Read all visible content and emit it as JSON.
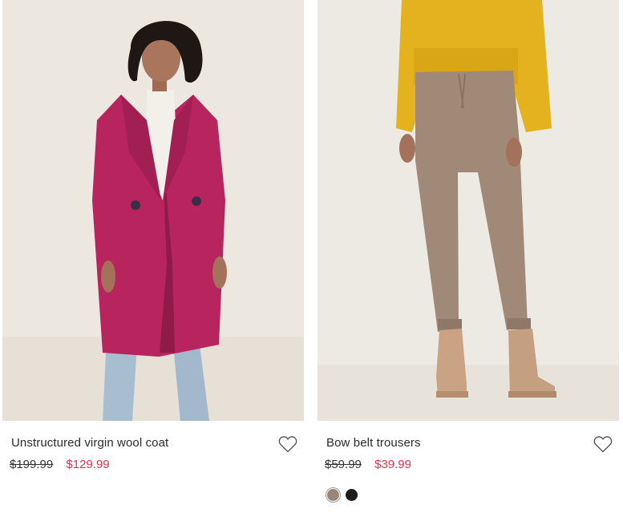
{
  "products": [
    {
      "title": "Unstructured virgin wool coat",
      "old_price": "$199.99",
      "new_price": "$129.99",
      "wishlist_icon": "heart-outline-icon"
    },
    {
      "title": "Bow belt trousers",
      "old_price": "$59.99",
      "new_price": "$39.99",
      "wishlist_icon": "heart-outline-icon",
      "swatches": [
        {
          "name": "brown",
          "color": "#9a8679"
        },
        {
          "name": "black",
          "color": "#1c1c1c"
        }
      ]
    }
  ],
  "colors": {
    "sale_price": "#e0354a",
    "coat": "#b8255e",
    "sweater": "#e3b21e",
    "trousers": "#a08977"
  }
}
